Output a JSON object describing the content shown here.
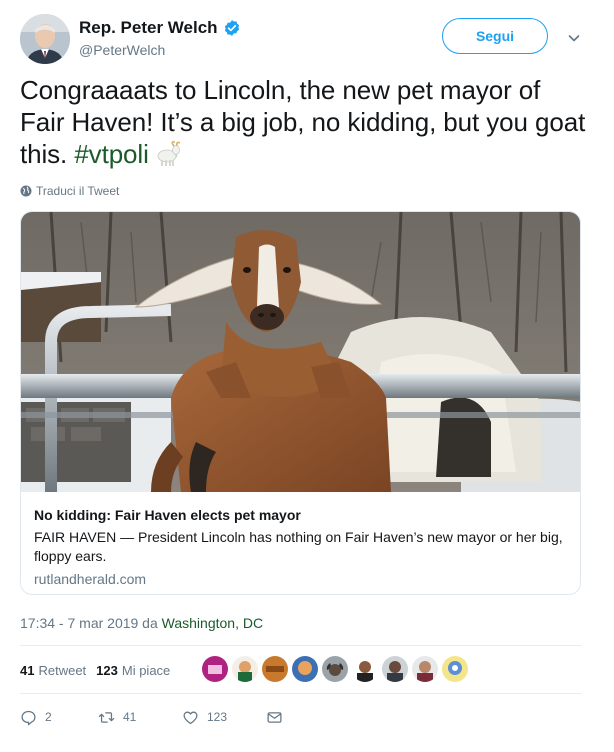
{
  "author": {
    "display_name": "Rep. Peter Welch",
    "handle": "@PeterWelch",
    "verified": true
  },
  "follow_button": {
    "label": "Segui"
  },
  "tweet": {
    "text_part1": "Congraaaats to Lincoln, the new pet mayor of Fair Haven! It’s a big job, no kidding, but you goat this.",
    "hashtag": "#vtpoli",
    "emoji": "goat-emoji"
  },
  "translate_link": "Traduci il Tweet",
  "card": {
    "title": "No kidding: Fair Haven elects pet mayor",
    "description": "FAIR HAVEN — President Lincoln has nothing on Fair Haven’s new mayor or her big, floppy ears.",
    "domain": "rutlandherald.com"
  },
  "timestamp": {
    "time_date": "17:34 - 7 mar 2019 da",
    "place": "Washington, DC"
  },
  "stats": {
    "retweets_count": "41",
    "retweets_label": "Retweet",
    "likes_count": "123",
    "likes_label": "Mi piace"
  },
  "actions": {
    "reply_count": "2",
    "retweet_count": "41",
    "like_count": "123"
  },
  "colors": {
    "accent": "#1da1f2",
    "hashtag": "#1b5b2a",
    "secondary_text": "#657786",
    "border": "#e1e8ed"
  }
}
